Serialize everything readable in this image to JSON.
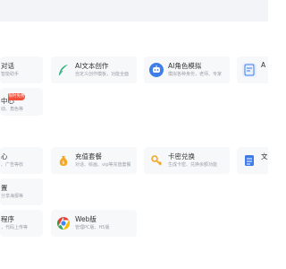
{
  "cards": {
    "r1c1": {
      "title": "对话",
      "desc": "智能助手"
    },
    "r1c2": {
      "title": "AI文本创作",
      "desc": "自定义创作模板，功能全面"
    },
    "r1c3": {
      "title": "AI角色模拟",
      "desc": "模拟各种身份，老师、专家"
    },
    "r1c4": {
      "title": "A"
    },
    "r2c1": {
      "title": "中心",
      "desc": "动、角色等",
      "badge": "限时免费"
    },
    "r3c1": {
      "title": "心",
      "desc": "、广告等收"
    },
    "r3c2": {
      "title": "充值套餐",
      "desc": "对话、绘画、vip等充值套餐"
    },
    "r3c3": {
      "title": "卡密兑换",
      "desc": "生成卡密、兑换余额功能"
    },
    "r3c4": {
      "title": "文"
    },
    "r4c1": {
      "title": "置",
      "desc": "分享海报等"
    },
    "r5c1": {
      "title": "程序",
      "desc": "，代码上传等"
    },
    "r5c2": {
      "title": "Web版",
      "desc": "管理PC版、H5版"
    }
  },
  "colors": {
    "topbar": "#f3f4f7",
    "card_bg": "#f7f8fa",
    "pen": "#2bb07a",
    "robot": "#3f7ee8",
    "money_bag": "#f5a623",
    "key": "#f5a623",
    "chrome_red": "#ea4335",
    "chrome_yellow": "#fbbc05",
    "chrome_green": "#34a853",
    "chrome_blue": "#4285f4",
    "badge": "#f0503c"
  },
  "icons": {
    "r1c2": "feather-pen-icon",
    "r1c3": "ai-robot-icon",
    "r1c4": "ai-document-icon",
    "r3c2": "money-bag-icon",
    "r3c3": "key-icon",
    "r3c4": "document-icon",
    "r5c2": "chrome-browser-icon"
  }
}
